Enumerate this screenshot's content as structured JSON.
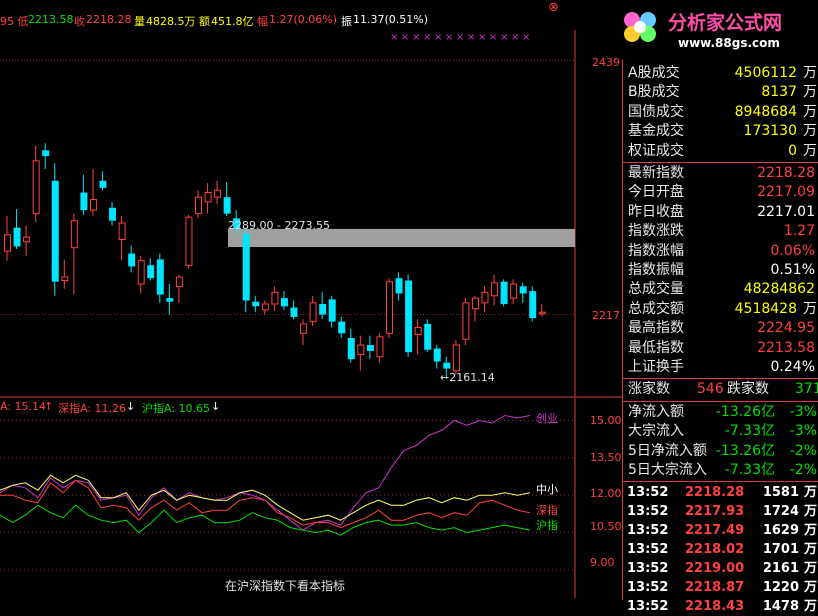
{
  "topbar": {
    "low_label": "95 低",
    "low_value": "2213.58",
    "close_label": "收",
    "close_value": "2218.28",
    "volume_label": "量",
    "volume_value": "4828.5万",
    "amount_label": "额",
    "amount_value": "451.8亿",
    "change_label": "幅",
    "change_value": "1.27(0.06%)",
    "amplitude_label": "振",
    "amplitude_value": "11.37(0.51%)"
  },
  "logo": {
    "title": "分析家公式网",
    "url": "www.88gs.com"
  },
  "close_glyph": "⊗",
  "main_chart": {
    "price_top_label": "2439",
    "price_mid_label": "2217",
    "band_label": "2289.00 - 2273.55",
    "low_marker": "←2161.14"
  },
  "lower_legend": {
    "a_label": "A: 15.14",
    "a_arrow": "↑",
    "shen_label": "深指A: 11.26",
    "shen_arrow": "↓",
    "hu_label": "沪指A: 10.65",
    "hu_arrow": "↓"
  },
  "lower_axis": [
    "15.00",
    "13.50",
    "12.00",
    "10.50",
    "9.00"
  ],
  "lower_series_labels": {
    "zhongxiao": "中小",
    "shenzhi": "深指",
    "huzhi": "沪指",
    "top": "创业"
  },
  "footer_note": "在沪深指数下看本指标",
  "colors": {
    "up": "#ff4040",
    "down": "#00e5ff",
    "panel_sep": "#d04040",
    "yellow": "#ffff00",
    "magenta": "#cc33cc"
  },
  "chart_data": {
    "type": "candlestick",
    "candles": [
      {
        "o": 2270,
        "h": 2300,
        "l": 2262,
        "c": 2284
      },
      {
        "o": 2290,
        "h": 2306,
        "l": 2272,
        "c": 2274
      },
      {
        "o": 2278,
        "h": 2292,
        "l": 2266,
        "c": 2282
      },
      {
        "o": 2302,
        "h": 2360,
        "l": 2295,
        "c": 2347
      },
      {
        "o": 2356,
        "h": 2362,
        "l": 2340,
        "c": 2351
      },
      {
        "o": 2330,
        "h": 2345,
        "l": 2232,
        "c": 2244
      },
      {
        "o": 2245,
        "h": 2263,
        "l": 2238,
        "c": 2248
      },
      {
        "o": 2273,
        "h": 2302,
        "l": 2233,
        "c": 2296
      },
      {
        "o": 2320,
        "h": 2335,
        "l": 2301,
        "c": 2305
      },
      {
        "o": 2305,
        "h": 2340,
        "l": 2300,
        "c": 2314
      },
      {
        "o": 2330,
        "h": 2338,
        "l": 2322,
        "c": 2324
      },
      {
        "o": 2307,
        "h": 2312,
        "l": 2292,
        "c": 2296
      },
      {
        "o": 2280,
        "h": 2300,
        "l": 2262,
        "c": 2294
      },
      {
        "o": 2268,
        "h": 2275,
        "l": 2252,
        "c": 2257
      },
      {
        "o": 2242,
        "h": 2266,
        "l": 2234,
        "c": 2262
      },
      {
        "o": 2258,
        "h": 2264,
        "l": 2245,
        "c": 2247
      },
      {
        "o": 2263,
        "h": 2268,
        "l": 2226,
        "c": 2233
      },
      {
        "o": 2230,
        "h": 2242,
        "l": 2216,
        "c": 2227
      },
      {
        "o": 2240,
        "h": 2250,
        "l": 2226,
        "c": 2248
      },
      {
        "o": 2258,
        "h": 2301,
        "l": 2255,
        "c": 2299
      },
      {
        "o": 2302,
        "h": 2322,
        "l": 2298,
        "c": 2316
      },
      {
        "o": 2312,
        "h": 2328,
        "l": 2302,
        "c": 2320
      },
      {
        "o": 2316,
        "h": 2330,
        "l": 2310,
        "c": 2322
      },
      {
        "o": 2316,
        "h": 2329,
        "l": 2300,
        "c": 2302
      },
      {
        "o": 2298,
        "h": 2305,
        "l": 2285,
        "c": 2289
      },
      {
        "o": 2285,
        "h": 2290,
        "l": 2218,
        "c": 2228
      },
      {
        "o": 2227,
        "h": 2232,
        "l": 2218,
        "c": 2223
      },
      {
        "o": 2220,
        "h": 2228,
        "l": 2216,
        "c": 2225
      },
      {
        "o": 2225,
        "h": 2240,
        "l": 2219,
        "c": 2235
      },
      {
        "o": 2230,
        "h": 2236,
        "l": 2220,
        "c": 2223
      },
      {
        "o": 2222,
        "h": 2228,
        "l": 2212,
        "c": 2214
      },
      {
        "o": 2200,
        "h": 2212,
        "l": 2190,
        "c": 2208
      },
      {
        "o": 2210,
        "h": 2232,
        "l": 2206,
        "c": 2226
      },
      {
        "o": 2225,
        "h": 2235,
        "l": 2212,
        "c": 2216
      },
      {
        "o": 2229,
        "h": 2232,
        "l": 2205,
        "c": 2210
      },
      {
        "o": 2210,
        "h": 2214,
        "l": 2196,
        "c": 2200
      },
      {
        "o": 2196,
        "h": 2204,
        "l": 2175,
        "c": 2178
      },
      {
        "o": 2182,
        "h": 2198,
        "l": 2168,
        "c": 2190
      },
      {
        "o": 2190,
        "h": 2198,
        "l": 2178,
        "c": 2185
      },
      {
        "o": 2180,
        "h": 2200,
        "l": 2175,
        "c": 2197
      },
      {
        "o": 2200,
        "h": 2247,
        "l": 2196,
        "c": 2244
      },
      {
        "o": 2247,
        "h": 2252,
        "l": 2228,
        "c": 2234
      },
      {
        "o": 2245,
        "h": 2250,
        "l": 2180,
        "c": 2184
      },
      {
        "o": 2199,
        "h": 2212,
        "l": 2182,
        "c": 2205
      },
      {
        "o": 2208,
        "h": 2212,
        "l": 2184,
        "c": 2186
      },
      {
        "o": 2187,
        "h": 2190,
        "l": 2170,
        "c": 2176
      },
      {
        "o": 2175,
        "h": 2180,
        "l": 2161,
        "c": 2170
      },
      {
        "o": 2168,
        "h": 2194,
        "l": 2165,
        "c": 2190
      },
      {
        "o": 2195,
        "h": 2230,
        "l": 2190,
        "c": 2226
      },
      {
        "o": 2221,
        "h": 2232,
        "l": 2210,
        "c": 2230
      },
      {
        "o": 2226,
        "h": 2240,
        "l": 2218,
        "c": 2235
      },
      {
        "o": 2232,
        "h": 2250,
        "l": 2224,
        "c": 2243
      },
      {
        "o": 2244,
        "h": 2246,
        "l": 2223,
        "c": 2225
      },
      {
        "o": 2230,
        "h": 2246,
        "l": 2225,
        "c": 2242
      },
      {
        "o": 2240,
        "h": 2243,
        "l": 2226,
        "c": 2234
      },
      {
        "o": 2236,
        "h": 2240,
        "l": 2210,
        "c": 2213
      },
      {
        "o": 2217,
        "h": 2225,
        "l": 2214,
        "c": 2218
      }
    ],
    "band": [
      2273.55,
      2289.0
    ],
    "lower_series": [
      {
        "name": "创业",
        "values": [
          12.1,
          12.4,
          12.3,
          11.9,
          12.7,
          12.3,
          12.6,
          12.5,
          11.8,
          11.9,
          12.0,
          11.2,
          11.9,
          12.3,
          11.8,
          12.1,
          11.9,
          11.8,
          11.9,
          12.1,
          12.0,
          11.8,
          11.4,
          11.0,
          10.6,
          10.9,
          11.0,
          10.8,
          11.5,
          12.1,
          12.3,
          13.1,
          13.8,
          14.0,
          14.4,
          14.6,
          15.0,
          14.8,
          15.0,
          14.9,
          15.2,
          15.1,
          15.2
        ]
      },
      {
        "name": "深指",
        "values": [
          12.0,
          12.0,
          11.8,
          11.7,
          12.5,
          12.1,
          12.6,
          12.3,
          11.5,
          11.6,
          11.5,
          11.0,
          11.5,
          11.8,
          11.4,
          11.7,
          11.3,
          11.4,
          11.4,
          11.8,
          11.9,
          11.8,
          11.3,
          11.1,
          10.8,
          10.9,
          10.9,
          10.7,
          10.9,
          11.1,
          11.4,
          11.0,
          11.0,
          11.2,
          11.3,
          11.1,
          11.3,
          11.2,
          11.7,
          11.8,
          11.6,
          11.4,
          11.3
        ]
      },
      {
        "name": "中小",
        "values": [
          12.2,
          12.4,
          12.5,
          12.2,
          12.8,
          12.5,
          12.8,
          12.6,
          11.9,
          11.9,
          12.1,
          11.4,
          12.0,
          12.2,
          11.8,
          12.0,
          11.9,
          11.8,
          11.8,
          12.1,
          12.2,
          12.0,
          11.6,
          11.3,
          11.0,
          11.1,
          11.2,
          11.0,
          11.3,
          11.6,
          11.8,
          11.6,
          11.6,
          11.8,
          11.9,
          11.7,
          11.9,
          11.8,
          12.0,
          12.0,
          12.1,
          12.0,
          12.1
        ]
      },
      {
        "name": "沪指",
        "values": [
          11.2,
          10.9,
          11.2,
          11.6,
          11.3,
          11.1,
          11.6,
          11.2,
          11.0,
          10.9,
          11.0,
          10.5,
          10.9,
          11.4,
          10.9,
          11.1,
          11.2,
          10.9,
          10.9,
          11.0,
          11.3,
          11.1,
          11.0,
          10.7,
          10.6,
          10.5,
          10.6,
          10.4,
          10.7,
          10.9,
          11.0,
          10.8,
          10.8,
          10.9,
          10.7,
          10.6,
          10.7,
          10.5,
          10.6,
          10.7,
          10.8,
          10.7,
          10.6
        ]
      }
    ],
    "lower_ylim": [
      9.0,
      15.5
    ],
    "main_ylim": [
      2150,
      2450
    ]
  },
  "panel": {
    "stats": [
      {
        "label": "A股成交",
        "value": "4506112",
        "unit": "万",
        "color": "yellow"
      },
      {
        "label": "B股成交",
        "value": "8137",
        "unit": "万",
        "color": "yellow"
      },
      {
        "label": "国债成交",
        "value": "8948684",
        "unit": "万",
        "color": "yellow"
      },
      {
        "label": "基金成交",
        "value": "173130",
        "unit": "万",
        "color": "yellow"
      },
      {
        "label": "权证成交",
        "value": "0",
        "unit": "万",
        "color": "yellow"
      }
    ],
    "index": [
      {
        "label": "最新指数",
        "value": "2218.28",
        "unit": "",
        "color": "red"
      },
      {
        "label": "今日开盘",
        "value": "2217.09",
        "unit": "",
        "color": "red"
      },
      {
        "label": "昨日收盘",
        "value": "2217.01",
        "unit": "",
        "color": "white"
      },
      {
        "label": "指数涨跌",
        "value": "1.27",
        "unit": "",
        "color": "red"
      },
      {
        "label": "指数涨幅",
        "value": "0.06%",
        "unit": "",
        "color": "red"
      },
      {
        "label": "指数振幅",
        "value": "0.51%",
        "unit": "",
        "color": "white"
      },
      {
        "label": "总成交量",
        "value": "48284862",
        "unit": "",
        "color": "yellow"
      },
      {
        "label": "总成交额",
        "value": "4518428",
        "unit": "万",
        "color": "yellow"
      },
      {
        "label": "最高指数",
        "value": "2224.95",
        "unit": "",
        "color": "red"
      },
      {
        "label": "最低指数",
        "value": "2213.58",
        "unit": "",
        "color": "red"
      },
      {
        "label": "上证换手",
        "value": "0.24%",
        "unit": "",
        "color": "white"
      }
    ],
    "advance_label": "涨家数",
    "advance_value": "546",
    "decline_label": "跌家数",
    "decline_value": "371",
    "flows": [
      {
        "label": "净流入额",
        "value": "-13.26亿",
        "pct": "-3%"
      },
      {
        "label": "大宗流入",
        "value": "-7.33亿",
        "pct": "-3%"
      },
      {
        "label": "5日净流入额",
        "value": "-13.26亿",
        "pct": "-2%"
      },
      {
        "label": "5日大宗流入",
        "value": "-7.33亿",
        "pct": "-2%"
      }
    ],
    "ticks": [
      {
        "time": "13:52",
        "price": "2218.28",
        "vol": "1581",
        "unit": "万"
      },
      {
        "time": "13:52",
        "price": "2217.93",
        "vol": "1724",
        "unit": "万"
      },
      {
        "time": "13:52",
        "price": "2217.49",
        "vol": "1629",
        "unit": "万"
      },
      {
        "time": "13:52",
        "price": "2218.02",
        "vol": "1701",
        "unit": "万"
      },
      {
        "time": "13:52",
        "price": "2219.00",
        "vol": "2161",
        "unit": "万"
      },
      {
        "time": "13:52",
        "price": "2218.87",
        "vol": "1220",
        "unit": "万"
      },
      {
        "time": "13:52",
        "price": "2218.43",
        "vol": "1478",
        "unit": "万"
      }
    ]
  }
}
